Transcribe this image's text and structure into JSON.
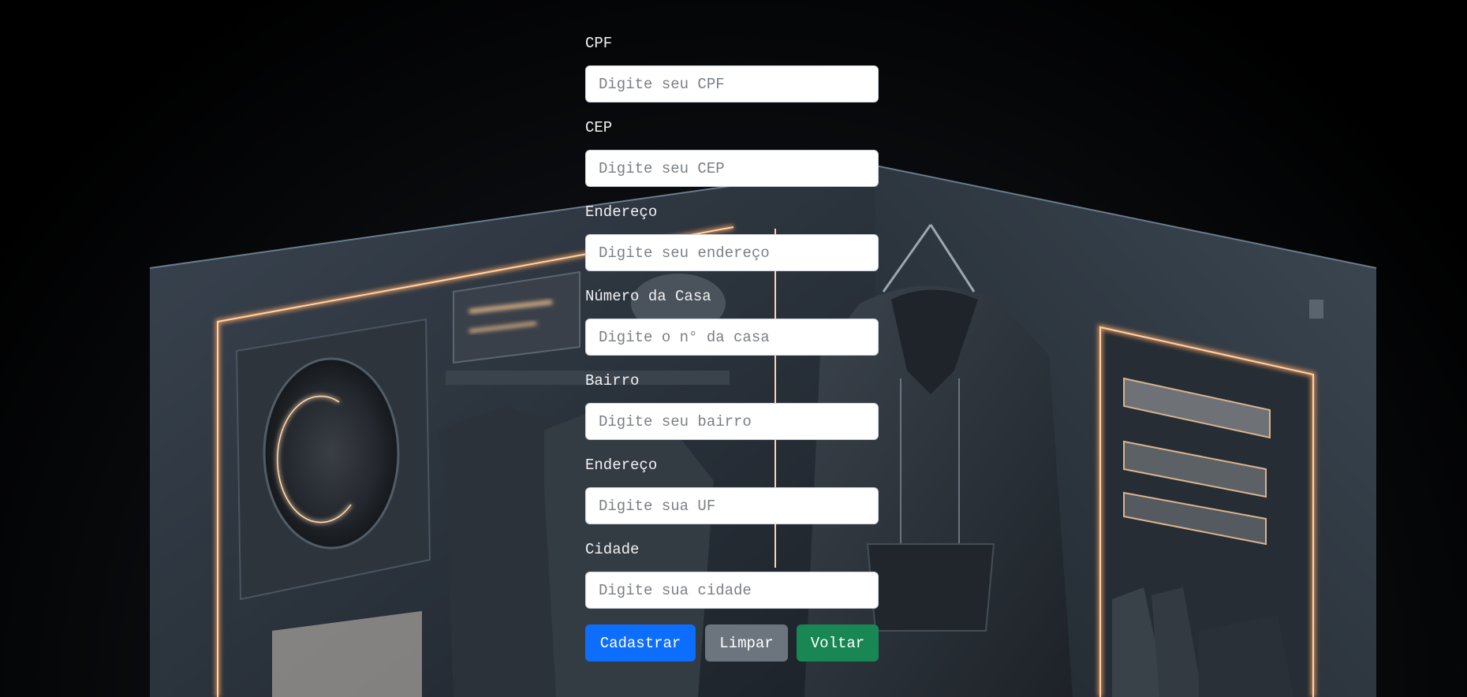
{
  "form": {
    "fields": [
      {
        "label": "CPF",
        "placeholder": "Digite seu CPF"
      },
      {
        "label": "CEP",
        "placeholder": "Digite seu CEP"
      },
      {
        "label": "Endereço",
        "placeholder": "Digite seu endereço"
      },
      {
        "label": "Número da Casa",
        "placeholder": "Digite o n° da casa"
      },
      {
        "label": "Bairro",
        "placeholder": "Digite seu bairro"
      },
      {
        "label": "Endereço",
        "placeholder": "Digite sua UF"
      },
      {
        "label": "Cidade",
        "placeholder": "Digite sua cidade"
      }
    ],
    "buttons": {
      "submit": "Cadastrar",
      "clear": "Limpar",
      "back": "Voltar"
    }
  },
  "colors": {
    "primary": "#0d6efd",
    "secondary": "#6c757d",
    "success": "#198754",
    "background": "#000000",
    "label": "#f2f2f2",
    "glow": "#f0a060"
  },
  "background": {
    "description_icon": "clothing-store-scene-image"
  }
}
